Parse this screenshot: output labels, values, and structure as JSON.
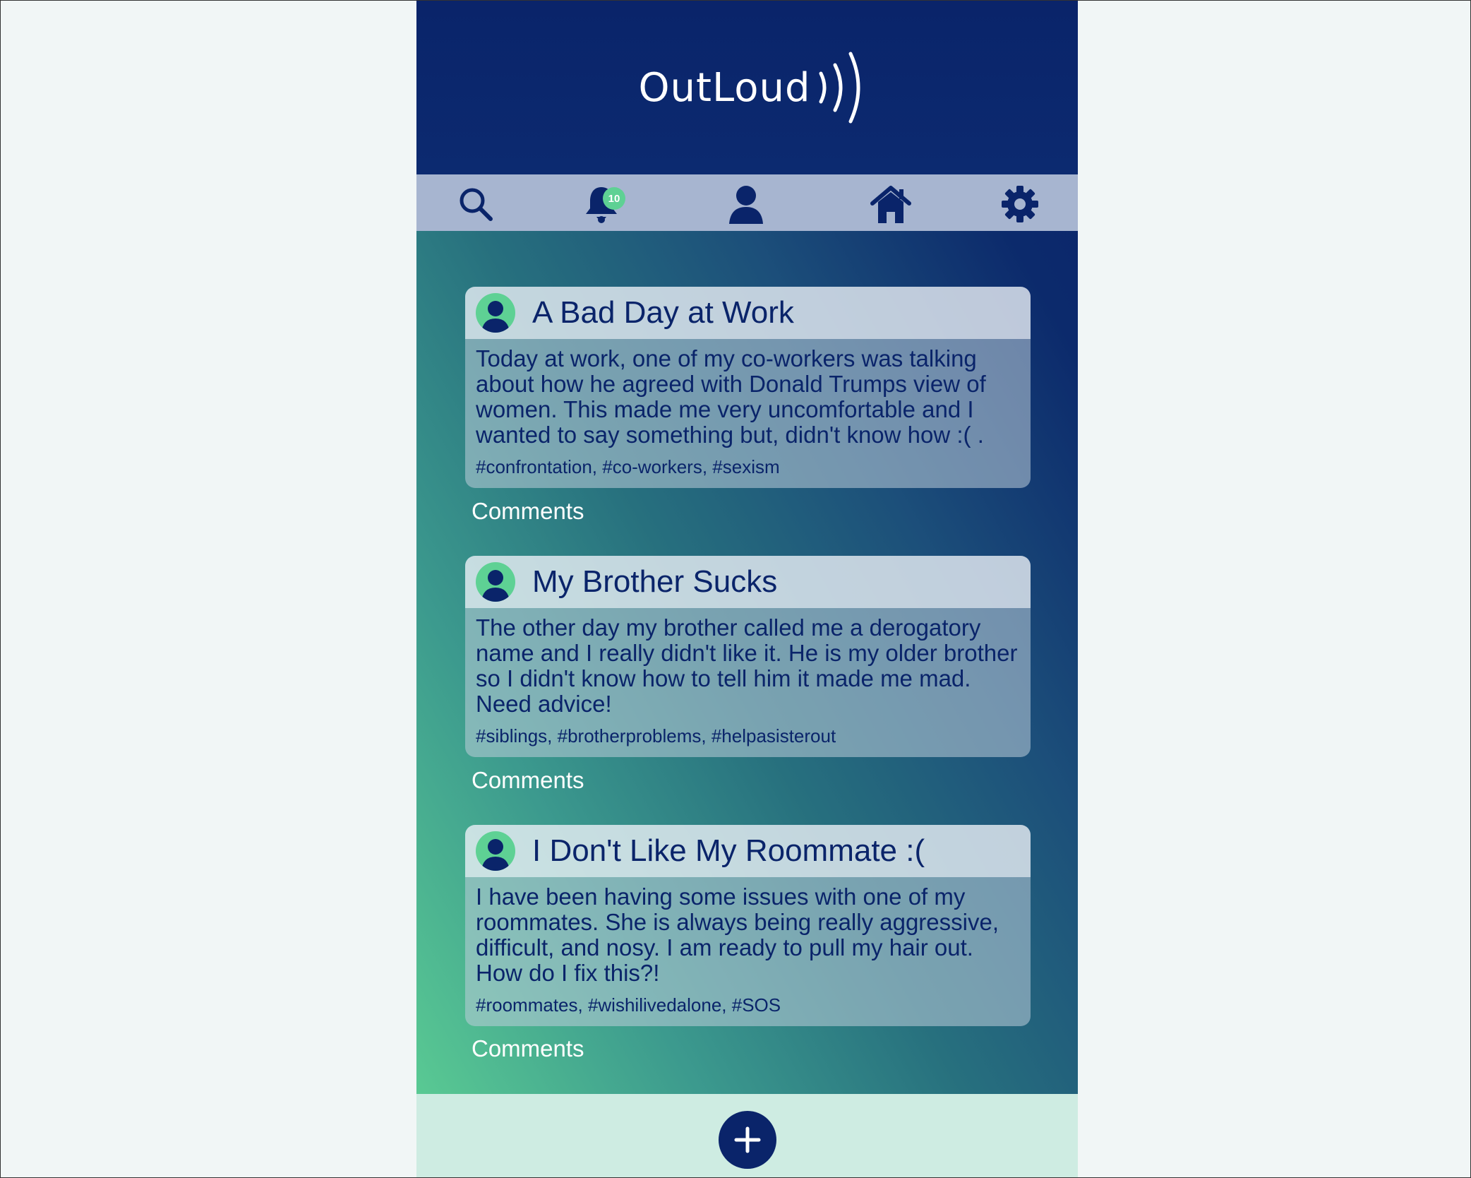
{
  "app": {
    "logo_text": "OutLoud",
    "logo_icon": "sound-waves-icon"
  },
  "nav": {
    "items": [
      {
        "name": "search",
        "icon": "search-icon"
      },
      {
        "name": "notifications",
        "icon": "bell-icon",
        "badge": "10"
      },
      {
        "name": "profile",
        "icon": "user-icon"
      },
      {
        "name": "home",
        "icon": "home-icon"
      },
      {
        "name": "settings",
        "icon": "gear-icon"
      }
    ]
  },
  "posts": [
    {
      "title": "A Bad Day at Work",
      "body": "Today at work, one of my co-workers was talking about how he agreed with Donald Trumps view of women. This made me very uncomfortable and I wanted to say something but, didn't know how :( .",
      "tags": "#confrontation, #co-workers, #sexism",
      "comments_label": "Comments"
    },
    {
      "title": "My Brother Sucks",
      "body": "The other day my brother called me a derogatory name and I really didn't like it. He is my older brother so I didn't know how to tell him it made me mad. Need advice!",
      "tags": "#siblings, #brotherproblems, #helpasisterout",
      "comments_label": "Comments"
    },
    {
      "title": "I Don't Like My Roommate :(",
      "body": "I have been having some issues with one of my roommates. She is always being really aggressive, difficult, and nosy. I am ready to pull my hair out. How do I fix this?!",
      "tags": "#roommates, #wishilivedalone, #SOS",
      "comments_label": "Comments"
    }
  ],
  "footer": {
    "add_icon": "plus-icon"
  },
  "colors": {
    "navy": "#0a246a",
    "mint": "#5ed194",
    "nav_bg": "#a7b5d0",
    "footer_bg": "#ceece2"
  }
}
